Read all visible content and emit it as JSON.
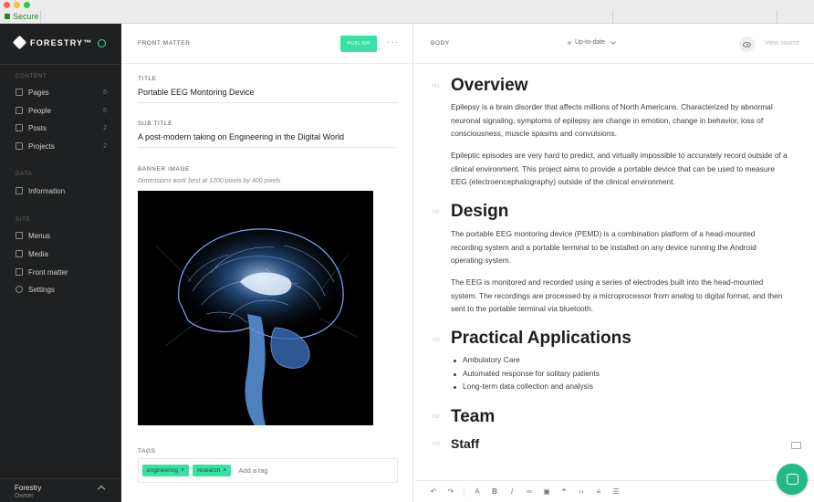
{
  "browser": {
    "security_label": "Secure"
  },
  "sidebar": {
    "brand": "FORESTRY™",
    "sections": [
      {
        "label": "CONTENT",
        "items": [
          {
            "label": "Pages",
            "count": "6",
            "icon": "pages-icon"
          },
          {
            "label": "People",
            "count": "6",
            "icon": "people-icon"
          },
          {
            "label": "Posts",
            "count": "2",
            "icon": "posts-icon"
          },
          {
            "label": "Projects",
            "count": "2",
            "icon": "projects-icon"
          }
        ]
      },
      {
        "label": "DATA",
        "items": [
          {
            "label": "Information",
            "count": "",
            "icon": "information-icon"
          }
        ]
      },
      {
        "label": "SITE",
        "items": [
          {
            "label": "Menus",
            "count": "",
            "icon": "menus-icon"
          },
          {
            "label": "Media",
            "count": "",
            "icon": "media-icon"
          },
          {
            "label": "Front matter",
            "count": "",
            "icon": "front-matter-icon"
          },
          {
            "label": "Settings",
            "count": "",
            "icon": "settings-icon"
          }
        ]
      }
    ],
    "footer": {
      "user": "Forestry",
      "role": "Owner"
    }
  },
  "front_matter": {
    "header_title": "FRONT MATTER",
    "publish_label": "PUBLISH",
    "more_label": "···",
    "title_label": "TITLE",
    "title_value": "Portable EEG Montoring Device",
    "subtitle_label": "SUB TITLE",
    "subtitle_value": "A post-modern taking on Engineering in the Digital World",
    "banner_label": "BANNER IMAGE",
    "banner_help": "Dimensions work best at 1200 pixels by 400 pixels",
    "tags_label": "TAGS",
    "tags": [
      "engineering",
      "research"
    ],
    "tag_placeholder": "Add a tag"
  },
  "body": {
    "header_title": "BODY",
    "status": "Up-to-date",
    "view_source": "View source",
    "sections": {
      "overview_heading": "Overview",
      "overview_p1": "Epilepsy is a brain disorder that affects millions of North Americans. Characterized by abnormal neuronal signaling, symptoms of epilepsy are change in emotion, change in behavior, loss of consciousness, muscle spasms and convulsions.",
      "overview_p2": "Epileptic episodes are very hard to predict, and virtually impossible to accurately record outside of a clinical environment. This project aims to provide a portable device that can be used to measure EEG (electroencephalography) outside of the clinical environment.",
      "design_heading": "Design",
      "design_p1": "The portable EEG montoring device (PEMD) is a combination platform of a head-mounted recording system and a portable terminal to be installed on any device running the Android operating system.",
      "design_p2": "The EEG is monitored and recorded using a series of electrodes built into the head-mounted system. The recordings are processed by a microprocessor from analog to digital format, and then sent to the portable terminal via bluetooth.",
      "apps_heading": "Practical Applications",
      "apps_items": [
        "Ambulatory Care",
        "Automated response for solitary patients",
        "Long-term data collection and analysis"
      ],
      "team_heading": "Team",
      "staff_heading": "Staff"
    },
    "heading_markers": {
      "h1": "H1",
      "h2": "H2",
      "h3": "H3"
    }
  },
  "colors": {
    "accent": "#3be0a5",
    "sidebar_bg": "#1f2021"
  }
}
